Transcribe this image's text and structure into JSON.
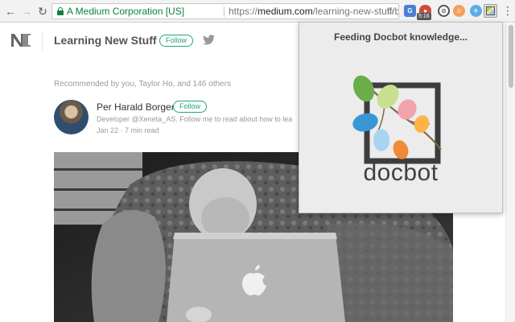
{
  "browser": {
    "ev_label": "A Medium Corporation [US]",
    "url_scheme": "https://",
    "url_host": "medium.com",
    "url_path": "/learning-new-stuff/building-your..."
  },
  "extensions": {
    "bug_badge": "5:16"
  },
  "header": {
    "publication_title": "Learning New Stuff",
    "follow_label": "Follow"
  },
  "article": {
    "recommended_text": "Recommended by you, Taylor Ho, and 146 others",
    "author_name": "Per Harald Borgen",
    "author_follow_label": "Follow",
    "author_bio": "Developer @Xeneta_AS. Follow me to read about how to lea",
    "post_date": "Jan 22",
    "read_time": "7 min read"
  },
  "popup": {
    "message": "Feeding Docbot knowledge...",
    "logo_text": "docbot"
  },
  "colors": {
    "secure_green": "#0b8043",
    "medium_green": "#1ea672",
    "popup_bg": "#ececec"
  }
}
